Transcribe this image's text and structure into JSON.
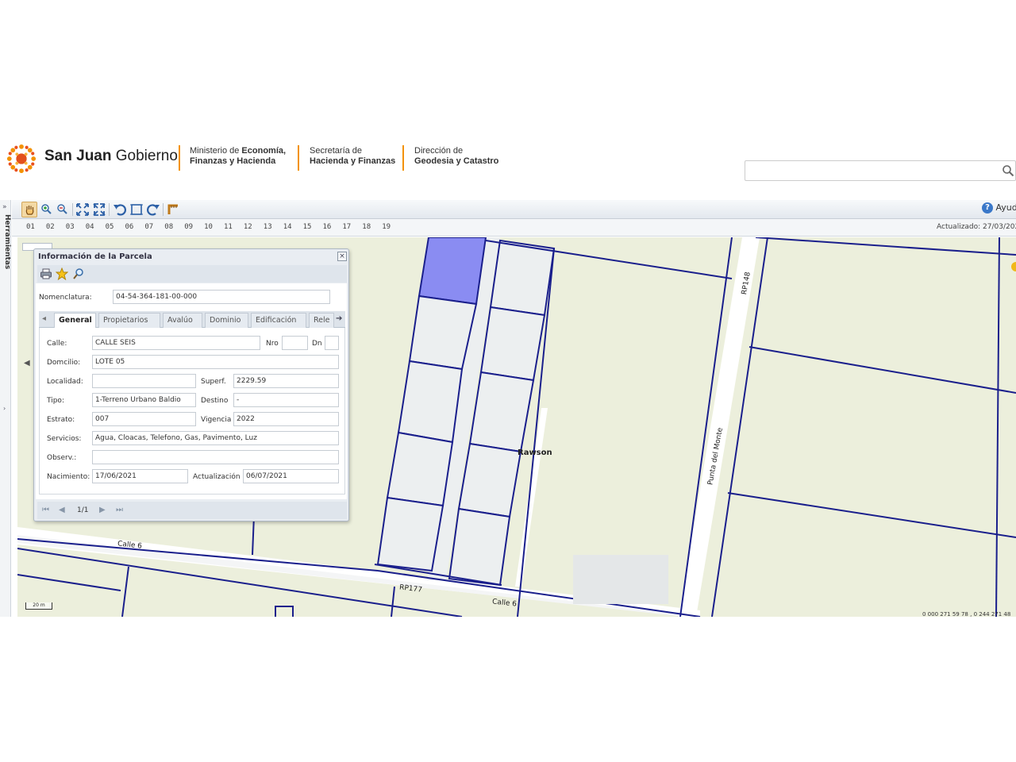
{
  "header": {
    "brand_bold": "San Juan",
    "brand_light": "Gobierno",
    "org1_line1": "Ministerio de ",
    "org1_line1_bold": "Economía,",
    "org1_line2": "Finanzas y Hacienda",
    "org2_line1": "Secretaría de",
    "org2_line2": "Hacienda y Finanzas",
    "org3_line1": "Dirección de",
    "org3_line2": "Geodesia y Catastro",
    "search_placeholder": ""
  },
  "side_panel": {
    "label": "Herramientas"
  },
  "toolbar": {
    "help_label": "Ayuda",
    "tools": [
      "pan-tool",
      "zoom-in-tool",
      "zoom-out-tool",
      "zoom-extent-tool",
      "full-extent-tool",
      "undo-tool",
      "select-tool",
      "redo-tool",
      "measure-tool"
    ]
  },
  "levels": {
    "items": [
      "01",
      "02",
      "03",
      "04",
      "05",
      "06",
      "07",
      "08",
      "09",
      "10",
      "11",
      "12",
      "13",
      "14",
      "15",
      "16",
      "17",
      "18",
      "19"
    ],
    "updated": "Actualizado: 27/03/202"
  },
  "map": {
    "labels": {
      "rawson": "Rawson",
      "calle6_a": "Calle 6",
      "calle6_b": "Calle 6",
      "rp177": "RP177",
      "rp148": "RP148",
      "punta": "Punta del Monte"
    },
    "scale": "20 m",
    "coords": "0 000 271 59 78 , 0 244 271 48",
    "colors": {
      "parcel_line": "#1a1f8c",
      "selected": "#8a8cf2",
      "land": "#ecefdc",
      "lot": "#eceff0",
      "road": "#ffffff"
    }
  },
  "popup": {
    "title": "Información de la Parcela",
    "nomenclatura_label": "Nomenclatura:",
    "nomenclatura_value": "04-54-364-181-00-000",
    "tabs": [
      "General",
      "Propietarios",
      "Avalúo",
      "Dominio",
      "Edificación",
      "Rele"
    ],
    "active_tab": "General",
    "fields": {
      "calle_label": "Calle:",
      "calle_value": "CALLE SEIS",
      "nro_label": "Nro",
      "nro_value": "",
      "dn_label": "Dn",
      "dn_value": "",
      "domicilio_label": "Domcilio:",
      "domicilio_value": "LOTE 05",
      "localidad_label": "Localidad:",
      "localidad_value": "",
      "superf_label": "Superf.",
      "superf_value": "2229.59",
      "tipo_label": "Tipo:",
      "tipo_value": "1-Terreno Urbano Baldio",
      "destino_label": "Destino",
      "destino_value": "-",
      "estrato_label": "Estrato:",
      "estrato_value": "007",
      "vigencia_label": "Vigencia",
      "vigencia_value": "2022",
      "servicios_label": "Servicios:",
      "servicios_value": "Agua, Cloacas, Telefono, Gas, Pavimento, Luz",
      "observ_label": "Observ.:",
      "observ_value": "",
      "nacimiento_label": "Nacimiento:",
      "nacimiento_value": "17/06/2021",
      "actualizacion_label": "Actualización",
      "actualizacion_value": "06/07/2021"
    },
    "pager": "1/1"
  }
}
